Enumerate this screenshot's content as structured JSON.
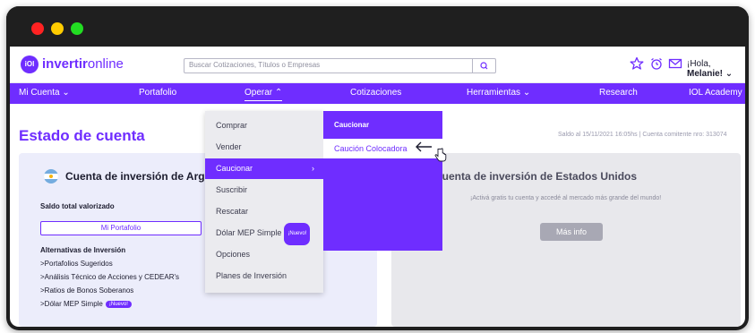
{
  "brand": {
    "logo_mark": "iOl",
    "name_bold": "invertir",
    "name_light": "online"
  },
  "header": {
    "search_placeholder": "Buscar Cotizaciones, Títulos o Empresas",
    "icons": [
      "star-icon",
      "alarm-clock-icon",
      "mail-icon"
    ],
    "greeting": "¡Hola,",
    "user_name": "Melanie!",
    "user_chevron": "⌄"
  },
  "nav": {
    "items": [
      {
        "label": "Mi Cuenta",
        "chevron": "⌄"
      },
      {
        "label": "Portafolio",
        "chevron": ""
      },
      {
        "label": "Operar",
        "chevron": "⌃"
      },
      {
        "label": "Cotizaciones",
        "chevron": ""
      },
      {
        "label": "Herramientas",
        "chevron": "⌄"
      },
      {
        "label": "Research",
        "chevron": ""
      },
      {
        "label": "IOL Academy",
        "chevron": ""
      }
    ]
  },
  "page": {
    "title": "Estado de cuenta",
    "saldo_text": "Saldo al 15/11/2021 16:05hs | Cuenta comitente nro: 313074"
  },
  "card_ar": {
    "title": "Cuenta de inversión de Argentina",
    "label": "Saldo total valorizado",
    "button": "Mi Portafolio",
    "alt_heading": "Alternativas de Inversión",
    "links": [
      ">Portafolios Sugeridos",
      ">Análisis Técnico de Acciones y CEDEAR's",
      ">Ratios de Bonos Soberanos",
      ">Dólar MEP Simple"
    ],
    "badge": "¡Nuevo!"
  },
  "card_us": {
    "title": "Cuenta de inversión de Estados Unidos",
    "subtitle": "¡Activá gratis tu cuenta y accedé al mercado más grande del mundo!",
    "button": "Más info"
  },
  "operar_menu": {
    "items": [
      "Comprar",
      "Vender",
      "Caucionar",
      "Suscribir",
      "Rescatar",
      "Dólar MEP Simple",
      "Opciones",
      "Planes de Inversión"
    ],
    "active_index": 2,
    "active_chevron": "›",
    "badge": "¡Nuevo!"
  },
  "caucionar_menu": {
    "heading": "Caucionar",
    "selected": "Caución Colocadora"
  },
  "colors": {
    "brand_purple": "#6f2dff",
    "dark_frame": "#1f1f1f"
  }
}
